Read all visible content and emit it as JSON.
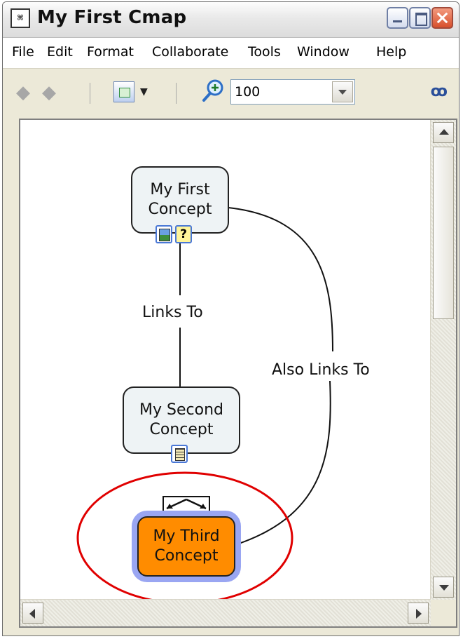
{
  "window": {
    "title": "My First Cmap",
    "app_icon": "cmap-app-icon",
    "controls": [
      "minimize",
      "maximize",
      "close"
    ]
  },
  "menu": {
    "items": [
      "File",
      "Edit",
      "Format",
      "Collaborate",
      "Tools",
      "Window",
      "Help"
    ]
  },
  "toolbar": {
    "back_icon": "arrow-left-icon",
    "forward_icon": "arrow-right-icon",
    "view_icon": "view-mode-icon",
    "zoom_icon": "zoom-in-icon",
    "zoom_value": "100",
    "collab_icon": "collaboration-icon"
  },
  "cmap": {
    "concepts": [
      {
        "label_line1": "My First",
        "label_line2": "Concept",
        "resources": [
          "image-resource-icon",
          "document-resource-icon"
        ]
      },
      {
        "label_line1": "My Second",
        "label_line2": "Concept",
        "resources": [
          "list-resource-icon"
        ]
      },
      {
        "label_line1": "My Third",
        "label_line2": "Concept",
        "selected": true
      }
    ],
    "links": [
      {
        "label": "Links To"
      },
      {
        "label": "Also Links To"
      }
    ]
  },
  "colors": {
    "selected_fill": "#ff8c00",
    "selection_halo": "#9aa6f2",
    "highlight_ellipse": "#e00000",
    "concept_fill": "#eef3f5"
  }
}
